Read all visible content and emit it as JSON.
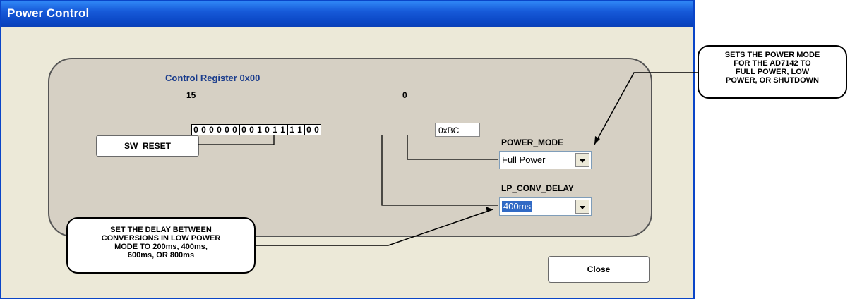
{
  "window": {
    "title": "Power Control"
  },
  "register": {
    "title": "Control Register 0x00",
    "msb_label": "15",
    "lsb_label": "0",
    "bit_groups": [
      [
        "0",
        "0",
        "0",
        "0",
        "0",
        "0"
      ],
      [
        "0",
        "0",
        "1",
        "0",
        "1",
        "1"
      ],
      [
        "1",
        "1"
      ],
      [
        "0",
        "0"
      ]
    ],
    "hex_value": "0xBC"
  },
  "sw_reset": {
    "label": "SW_RESET"
  },
  "power_mode": {
    "label": "POWER_MODE",
    "value": "Full Power"
  },
  "lp_conv_delay": {
    "label": "LP_CONV_DELAY",
    "value": "400ms"
  },
  "close": {
    "label": "Close"
  },
  "callouts": {
    "power_mode_note": [
      "SETS THE POWER MODE",
      "FOR THE AD7142 TO",
      "FULL POWER, LOW",
      "POWER, OR SHUTDOWN"
    ],
    "delay_note": [
      "SET THE DELAY BETWEEN",
      "CONVERSIONS IN LOW POWER",
      "MODE TO 200ms, 400ms,",
      "600ms, OR 800ms"
    ]
  },
  "colors": {
    "titlebar": "#0b47c5",
    "panel": "#d6d0c4",
    "window": "#ece9d8",
    "selection": "#316ac5"
  },
  "icons": {
    "dropdown": "chevron-down-icon"
  }
}
